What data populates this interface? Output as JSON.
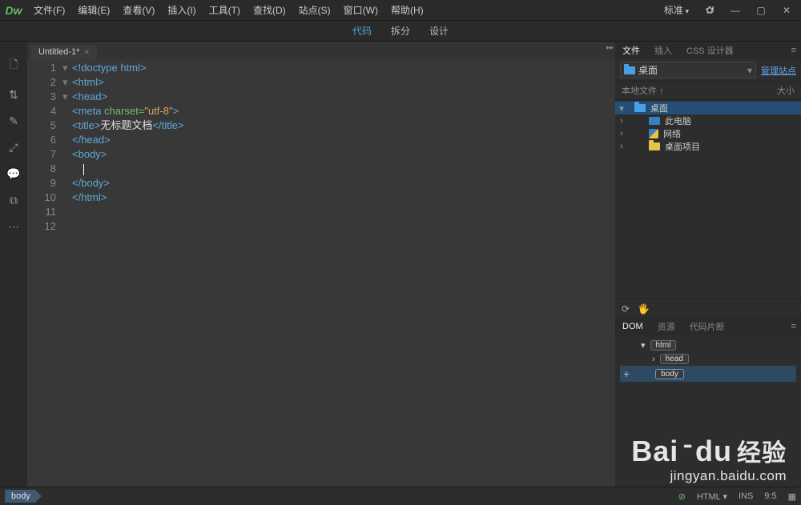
{
  "app": {
    "logo": "Dw"
  },
  "menu": {
    "file": "文件(F)",
    "edit": "编辑(E)",
    "view": "查看(V)",
    "insert": "插入(I)",
    "tools": "工具(T)",
    "find": "查找(D)",
    "site": "站点(S)",
    "window": "窗口(W)",
    "help": "帮助(H)"
  },
  "workspace": {
    "label": "标准"
  },
  "viewmode": {
    "code": "代码",
    "split": "拆分",
    "design": "设计"
  },
  "tab": {
    "name": "Untitled-1*",
    "close": "×"
  },
  "gutter": [
    "1",
    "2",
    "3",
    "4",
    "5",
    "6",
    "7",
    "8",
    "9",
    "10",
    "11",
    "12"
  ],
  "fold": [
    "",
    "▾",
    "▾",
    "",
    "",
    "",
    "",
    "▾",
    "",
    "",
    "",
    ""
  ],
  "code_lines": [
    {
      "html": "<span class='tag'>&lt;!doctype html&gt;</span>"
    },
    {
      "html": "<span class='tag'>&lt;html&gt;</span>"
    },
    {
      "html": "<span class='tag'>&lt;head&gt;</span>"
    },
    {
      "html": "<span class='tag'>&lt;meta </span><span class='attr'>charset=</span><span class='str'>\"utf-8\"</span><span class='tag'>&gt;</span>"
    },
    {
      "html": "<span class='tag'>&lt;title&gt;</span><span class='txt'>无标题文档</span><span class='tag'>&lt;/title&gt;</span>"
    },
    {
      "html": "<span class='tag'>&lt;/head&gt;</span>"
    },
    {
      "html": ""
    },
    {
      "html": "<span class='tag'>&lt;body&gt;</span>"
    },
    {
      "html": "    <span class='cursor-line'></span>"
    },
    {
      "html": "<span class='tag'>&lt;/body&gt;</span>"
    },
    {
      "html": "<span class='tag'>&lt;/html&gt;</span>"
    },
    {
      "html": ""
    }
  ],
  "status": {
    "crumb": "body",
    "lang": "HTML",
    "ins": "INS",
    "pos": "9:5"
  },
  "panels": {
    "files": {
      "tab_files": "文件",
      "tab_insert": "插入",
      "tab_css": "CSS 设计器",
      "selector": "桌面",
      "manage": "管理站点",
      "col_local": "本地文件 ↑",
      "col_size": "大小",
      "tree": [
        {
          "twist": "▾",
          "indent": 0,
          "icon": "folder-icon",
          "label": "桌面",
          "sel": true
        },
        {
          "twist": "›",
          "indent": 18,
          "icon": "pc-icon",
          "label": "此电脑"
        },
        {
          "twist": "›",
          "indent": 18,
          "icon": "py-icon",
          "label": "网络"
        },
        {
          "twist": "›",
          "indent": 18,
          "icon": "fy-icon",
          "label": "桌面项目"
        }
      ]
    },
    "dom": {
      "tab_dom": "DOM",
      "tab_res": "资源",
      "tab_snip": "代码片断",
      "nodes": [
        {
          "twist": "▾",
          "indent": 0,
          "label": "html",
          "sel": false
        },
        {
          "twist": "›",
          "indent": 14,
          "label": "head",
          "sel": false
        },
        {
          "twist": "",
          "indent": 14,
          "label": "body",
          "sel": true,
          "plus": true
        }
      ]
    }
  },
  "watermark": {
    "brand": "Bai",
    "du": "du",
    "cn": "经验",
    "url": "jingyan.baidu.com"
  }
}
